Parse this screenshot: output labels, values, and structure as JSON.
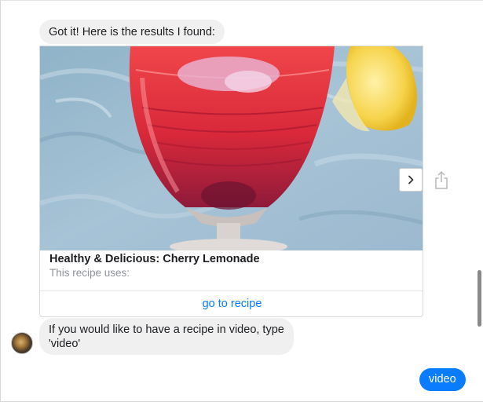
{
  "messages": {
    "bot_intro": "Got it! Here is the results I found:",
    "bot_video_prompt": "If you would like to have a recipe in video, type 'video'",
    "user_reply": "video"
  },
  "recipe_card": {
    "title": "Healthy & Delicious: Cherry Lemonade",
    "subtitle": "This recipe uses:",
    "action_label": "go to recipe",
    "image_description_icon": "cherry-lemonade-photo"
  },
  "carousel": {
    "next_icon": "chevron-right-icon",
    "share_icon": "share-icon"
  },
  "colors": {
    "accent": "#0a7cff",
    "bubble_bg": "#f0f0f0",
    "text": "#1c1e21",
    "muted": "#90949c"
  }
}
